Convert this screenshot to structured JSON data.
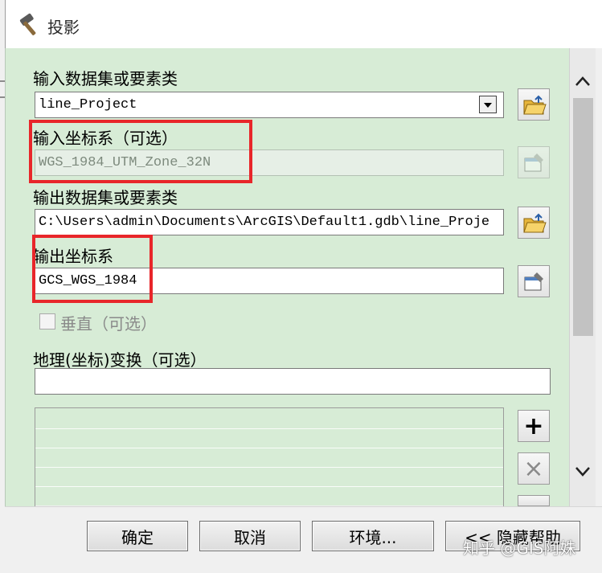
{
  "window": {
    "title": "投影",
    "icon": "hammer-icon"
  },
  "form": {
    "input_dataset_label": "输入数据集或要素类",
    "input_dataset_value": "line_Project",
    "input_cs_label": "输入坐标系（可选）",
    "input_cs_value": "WGS_1984_UTM_Zone_32N",
    "output_dataset_label": "输出数据集或要素类",
    "output_dataset_value": "C:\\Users\\admin\\Documents\\ArcGIS\\Default1.gdb\\line_Proje",
    "output_cs_label": "输出坐标系",
    "output_cs_value": "GCS_WGS_1984",
    "vertical_label": "垂直（可选）",
    "vertical_checked": false,
    "transform_label": "地理(坐标)变换（可选）",
    "transform_value": ""
  },
  "side_buttons": {
    "add": "+",
    "remove": "×"
  },
  "footer": {
    "ok_label": "确定",
    "cancel_label": "取消",
    "env_label": "环境...",
    "help_label": "<< 隐藏帮助"
  },
  "watermark": "知乎 @GIS阿姝",
  "colors": {
    "panel_bg": "#d7ecd6",
    "highlight": "#e8262a"
  }
}
